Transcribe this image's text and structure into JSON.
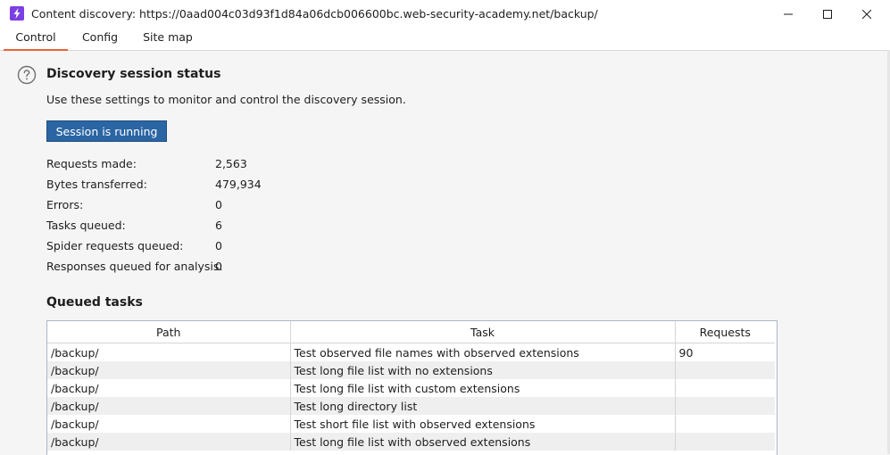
{
  "window": {
    "title": "Content discovery: https://0aad004c03d93f1d84a06dcb006600bc.web-security-academy.net/backup/",
    "minimize_glyph": "—",
    "close_glyph": "✕"
  },
  "tabs": [
    {
      "label": "Control",
      "active": true
    },
    {
      "label": "Config",
      "active": false
    },
    {
      "label": "Site map",
      "active": false
    }
  ],
  "status": {
    "heading": "Discovery session status",
    "description": "Use these settings to monitor and control the discovery session.",
    "button_label": "Session is running",
    "stats": [
      {
        "label": "Requests made:",
        "value": "2,563"
      },
      {
        "label": "Bytes transferred:",
        "value": "479,934"
      },
      {
        "label": "Errors:",
        "value": "0"
      },
      {
        "label": "Tasks queued:",
        "value": "6"
      },
      {
        "label": "Spider requests queued:",
        "value": "0"
      },
      {
        "label": "Responses queued for analysis:",
        "value": "0"
      }
    ]
  },
  "queued": {
    "heading": "Queued tasks",
    "columns": [
      "Path",
      "Task",
      "Requests"
    ],
    "rows": [
      {
        "path": "/backup/",
        "task": "Test observed file names with observed extensions",
        "requests": "90"
      },
      {
        "path": "/backup/",
        "task": "Test long file list with no extensions",
        "requests": ""
      },
      {
        "path": "/backup/",
        "task": "Test long file list with custom extensions",
        "requests": ""
      },
      {
        "path": "/backup/",
        "task": "Test long directory list",
        "requests": ""
      },
      {
        "path": "/backup/",
        "task": "Test short file list with observed extensions",
        "requests": ""
      },
      {
        "path": "/backup/",
        "task": "Test long file list with observed extensions",
        "requests": ""
      }
    ]
  },
  "colors": {
    "accent_tab": "#e8633a",
    "button_bg": "#2b65a3",
    "app_icon": "#7b3fe4"
  },
  "icons": {
    "app": "burp-lightning-icon",
    "help": "help-icon"
  }
}
